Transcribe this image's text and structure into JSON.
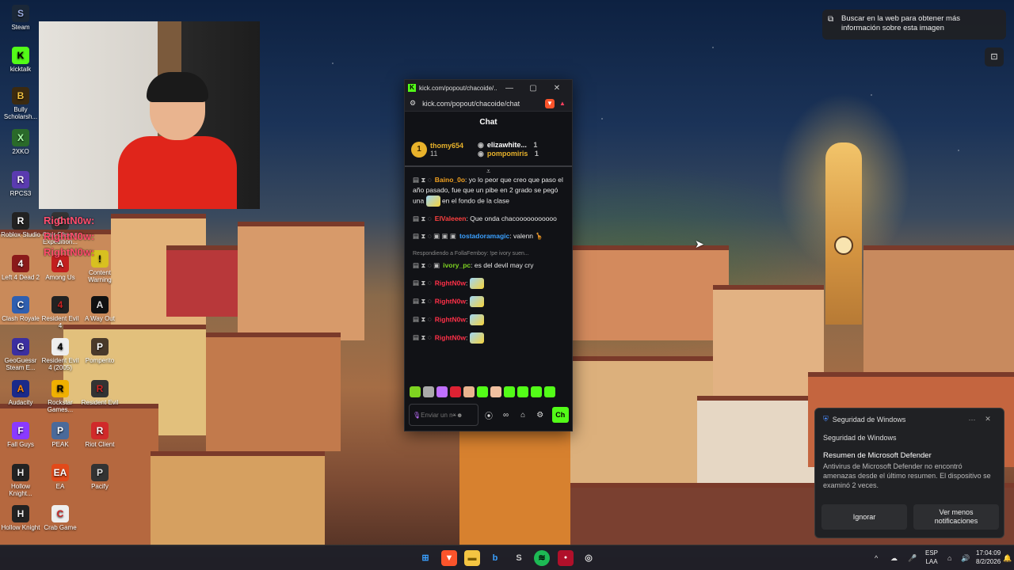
{
  "desktop": {
    "icons": [
      {
        "label": "Steam"
      },
      {
        "label": "kicktalk"
      },
      {
        "label": "Bully Scholarsh..."
      },
      {
        "label": "2XKO"
      },
      {
        "label": "RPCS3"
      },
      {
        "label": "Roblox Studio"
      },
      {
        "label": "Clair Obscur Expedition..."
      },
      {
        "label": "Content Warning"
      },
      {
        "label": "Left 4 Dead 2"
      },
      {
        "label": "Among Us"
      },
      {
        "label": "Clash Royale"
      },
      {
        "label": "Resident Evil 4"
      },
      {
        "label": "A Way Out"
      },
      {
        "label": "GeoGuessr Steam E..."
      },
      {
        "label": "Resident Evil 4 (2005)"
      },
      {
        "label": "Pomperito"
      },
      {
        "label": "Audacity"
      },
      {
        "label": "Rockstar Games..."
      },
      {
        "label": "Resident Evil"
      },
      {
        "label": "Fall Guys"
      },
      {
        "label": "PEAK"
      },
      {
        "label": "Riot Client"
      },
      {
        "label": "Hollow Knight..."
      },
      {
        "label": "EA"
      },
      {
        "label": "Pacify"
      },
      {
        "label": "Hollow Knight"
      },
      {
        "label": "Crab Game"
      }
    ]
  },
  "overlay": {
    "rightnow_lines": [
      "RightN0w:",
      "RightN0w:",
      "RightN0w:"
    ]
  },
  "window": {
    "title": "kick.com/popout/chacoide/...",
    "url": "kick.com/popout/chacoide/chat",
    "minimize": "—",
    "maximize": "▢",
    "close": "✕"
  },
  "chat": {
    "header": "Chat",
    "leaderboard": {
      "rank": "1",
      "top_user": "thomy654",
      "top_count": "11",
      "second_user": "elizawhite...",
      "second_count": "1",
      "third_user": "pompomiris",
      "third_count": "1"
    },
    "messages": [
      {
        "user": "Baino_0o",
        "text": "yo lo peor que creo que paso el año pasado, fue que un pibe en 2 grado se pegó una",
        "text2": "en el fondo de la clase"
      },
      {
        "user": "ElValeeen",
        "text": "Que onda chacooooooooooo"
      },
      {
        "user": "tostadoramagic",
        "text": "valenn"
      },
      {
        "reply": "Respondiendo a FollaFemboy: !pe ivory suen...",
        "user": "ivory_pc",
        "text": "es del devil may cry"
      },
      {
        "user": "RightN0w"
      },
      {
        "user": "RightN0w"
      },
      {
        "user": "RightN0w"
      },
      {
        "user": "RightN0w"
      }
    ],
    "input_placeholder": "Enviar un mensaje",
    "send_label": "Ch"
  },
  "lens": {
    "text": "Buscar en la web para obtener más información sobre esta imagen"
  },
  "toast": {
    "app": "Seguridad de Windows",
    "subtitle": "Seguridad de Windows",
    "title": "Resumen de Microsoft Defender",
    "body": "Antivirus de Microsoft Defender no encontró amenazas desde el último resumen. El dispositivo se examinó 2 veces.",
    "dismiss": "Ignorar",
    "less": "Ver menos notificaciones"
  },
  "taskbar": {
    "lang_top": "ESP",
    "lang_bottom": "LAA",
    "time": "17:04:09",
    "date": "8/2/2026"
  },
  "colors": {
    "kick_green": "#53fc18",
    "lead_gold": "#e8b22b",
    "username_red": "#ff3048"
  }
}
